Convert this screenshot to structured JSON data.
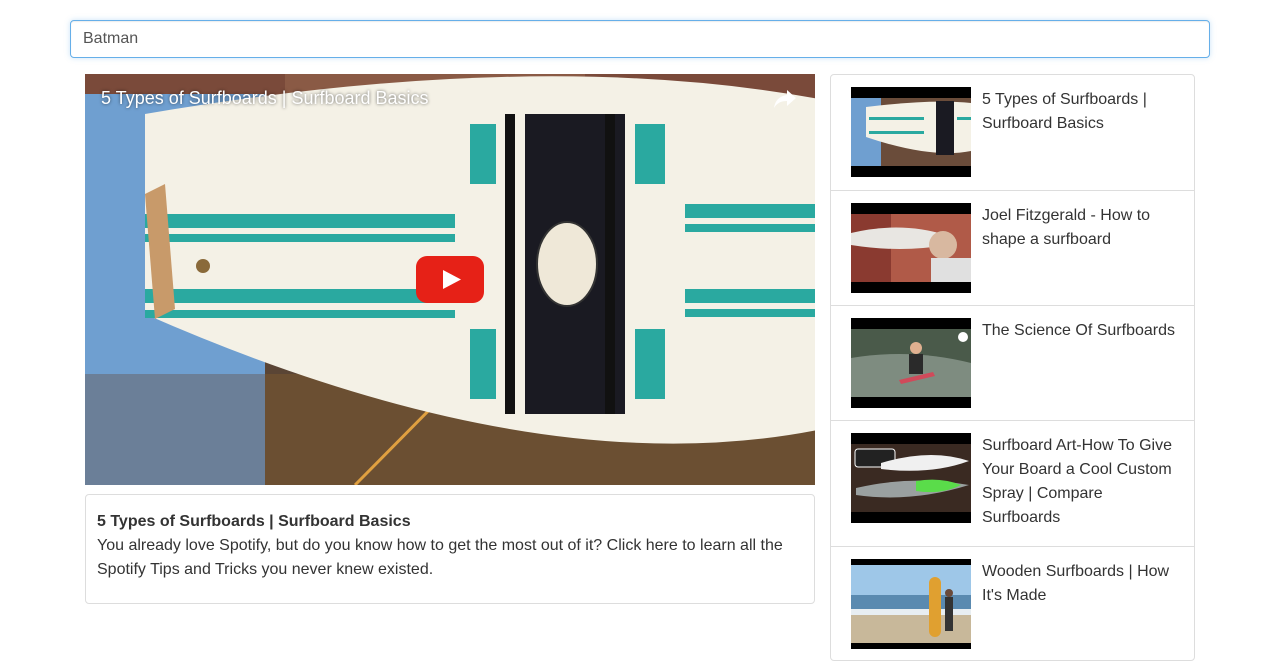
{
  "search": {
    "value": "Batman",
    "placeholder": ""
  },
  "player": {
    "title": "5 Types of Surfboards | Surfboard Basics",
    "share_icon": "share-icon",
    "play_icon": "youtube-play-icon",
    "accent": "#e62117"
  },
  "detail": {
    "title": "5 Types of Surfboards | Surfboard Basics",
    "description": "You already love Spotify, but do you know how to get the most out of it? Click here to learn all the Spotify Tips and Tricks you never knew existed."
  },
  "videos": [
    {
      "title": "5 Types of Surfboards | Surfboard Basics"
    },
    {
      "title": "Joel Fitzgerald - How to shape a surfboard"
    },
    {
      "title": "The Science Of Surfboards"
    },
    {
      "title": "Surfboard Art-How To Give Your Board a Cool Custom Spray | Compare Surfboards"
    },
    {
      "title": "Wooden Surfboards | How It's Made"
    }
  ]
}
